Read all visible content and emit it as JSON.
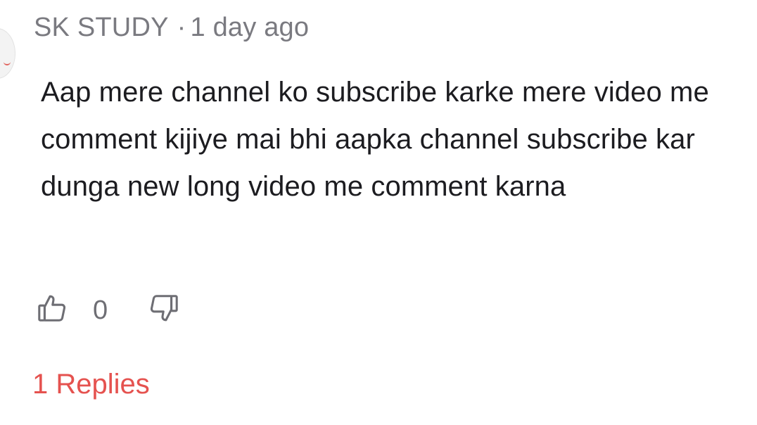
{
  "comment": {
    "author": "SK STUDY",
    "separator": "·",
    "timestamp": "1 day ago",
    "text": "Aap mere channel ko subscribe karke mere video me comment kijiye mai bhi aapka channel subscribe kar dunga new long video me comment karna",
    "like_count": "0",
    "replies_label": "1 Replies"
  },
  "icons": {
    "like": "thumbs-up-icon",
    "dislike": "thumbs-down-icon"
  },
  "colors": {
    "meta_text": "#7a7a80",
    "body_text": "#1c1c20",
    "icon_stroke": "#6e6e74",
    "replies_accent": "#e5524f"
  }
}
